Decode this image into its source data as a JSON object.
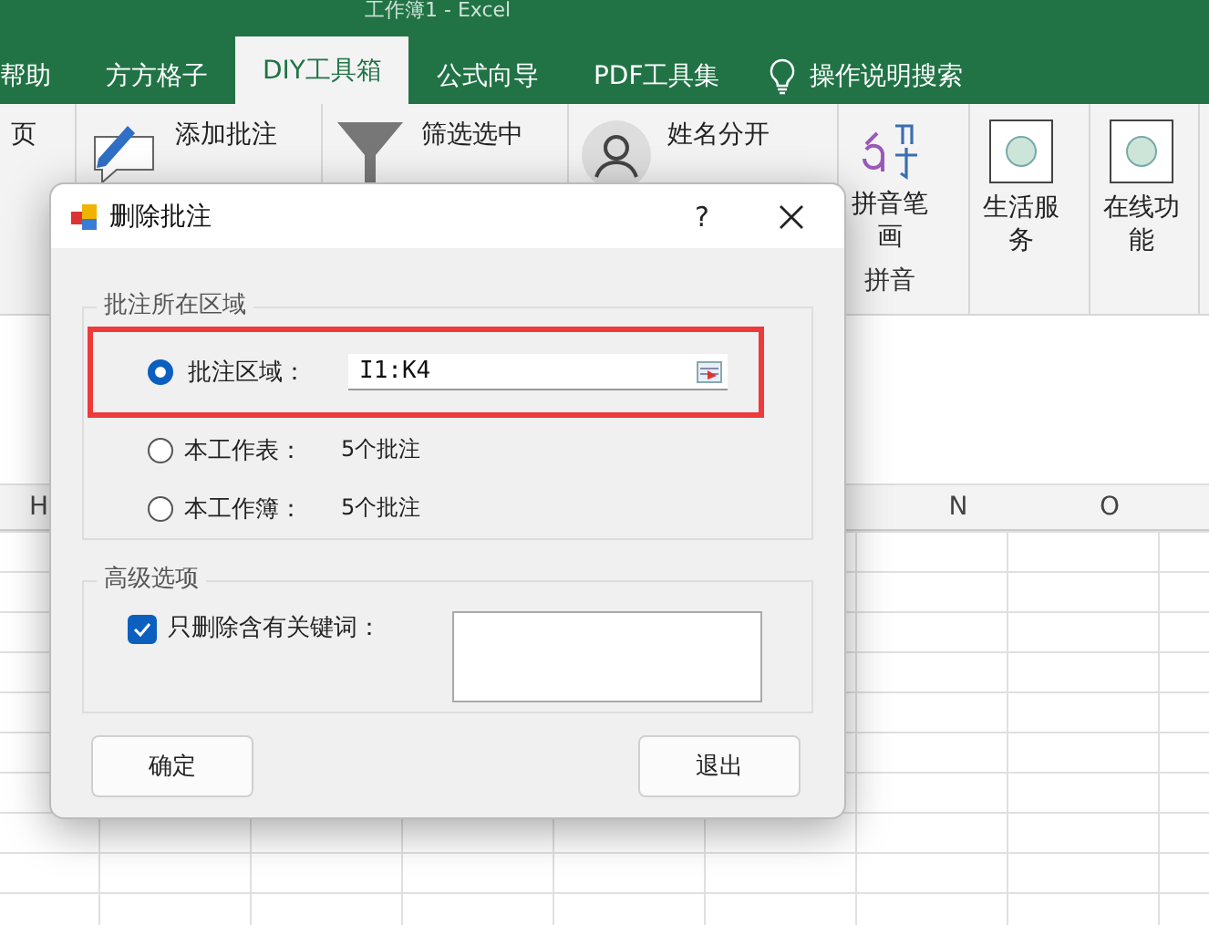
{
  "window": {
    "title": "工作簿1 - Excel"
  },
  "tabs": [
    {
      "label": "帮助",
      "selected": false
    },
    {
      "label": "方方格子",
      "selected": false
    },
    {
      "label": "DIY工具箱",
      "selected": true
    },
    {
      "label": "公式向导",
      "selected": false
    },
    {
      "label": "PDF工具集",
      "selected": false
    }
  ],
  "tell_me": "操作说明搜索",
  "ribbon": {
    "cut_label": "页",
    "comment_buttons": [
      "添加批注"
    ],
    "filter_buttons": [
      "筛选选中"
    ],
    "name_buttons": [
      "姓名分开"
    ],
    "pinyin": {
      "label": "拼音笔画",
      "group": "拼音"
    },
    "big_buttons": [
      "生活服务",
      "在线功能"
    ]
  },
  "sheet": {
    "columns": [
      "H",
      "N",
      "O"
    ]
  },
  "dialog": {
    "title": "删除批注",
    "help": "?",
    "scope_group": "批注所在区域",
    "options": [
      {
        "label": "批注区域：",
        "selected": true,
        "value": "I1:K4"
      },
      {
        "label": "本工作表：",
        "selected": false,
        "note": "5个批注"
      },
      {
        "label": "本工作簿：",
        "selected": false,
        "note": "5个批注"
      }
    ],
    "advanced_group": "高级选项",
    "keyword": {
      "label": "只删除含有关键词：",
      "checked": true
    },
    "buttons": [
      "确定",
      "退出"
    ]
  }
}
